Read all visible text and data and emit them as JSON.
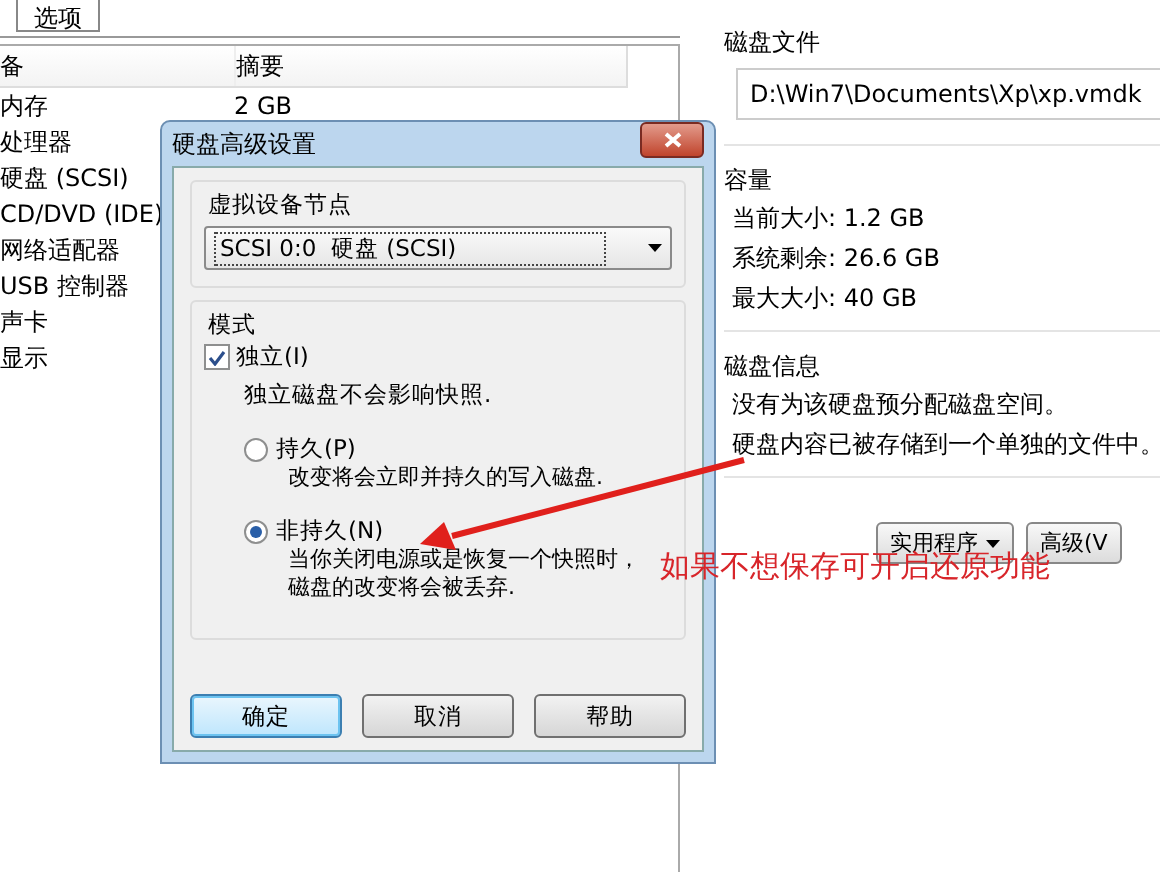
{
  "tabs": [
    {
      "label": "选项",
      "selected": true
    }
  ],
  "device_list": {
    "columns": [
      "备",
      "摘要"
    ],
    "rows": [
      {
        "device": "内存",
        "summary": "2 GB"
      },
      {
        "device": "处理器",
        "summary": ""
      },
      {
        "device": "硬盘 (SCSI)",
        "summary": ""
      },
      {
        "device": "CD/DVD (IDE)",
        "summary": ""
      },
      {
        "device": "网络适配器",
        "summary": ""
      },
      {
        "device": "USB 控制器",
        "summary": ""
      },
      {
        "device": "声卡",
        "summary": ""
      },
      {
        "device": "显示",
        "summary": ""
      }
    ]
  },
  "details": {
    "disk_file": {
      "title": "磁盘文件",
      "value": "D:\\Win7\\Documents\\Xp\\xp.vmdk"
    },
    "capacity": {
      "title": "容量",
      "lines": [
        "当前大小: 1.2 GB",
        "系统剩余: 26.6 GB",
        "最大大小: 40 GB"
      ]
    },
    "disk_info": {
      "title": "磁盘信息",
      "lines": [
        "没有为该硬盘预分配磁盘空间。",
        "硬盘内容已被存储到一个单独的文件中。"
      ]
    },
    "buttons": [
      {
        "label": "实用程序",
        "dropdown": true
      },
      {
        "label": "高级(V",
        "dropdown": false
      }
    ]
  },
  "dialog": {
    "title": "硬盘高级设置",
    "node": {
      "title": "虚拟设备节点",
      "value": "SCSI 0:0  硬盘 (SCSI)"
    },
    "mode": {
      "title": "模式",
      "independent": {
        "label": "独立(I)",
        "checked": true
      },
      "note": "独立磁盘不会影响快照.",
      "options": [
        {
          "label": "持久(P)",
          "selected": false,
          "description_lines": [
            "改变将会立即并持久的写入磁盘."
          ]
        },
        {
          "label": "非持久(N)",
          "selected": true,
          "description_lines": [
            "当你关闭电源或是恢复一个快照时，",
            "磁盘的改变将会被丢弃."
          ]
        }
      ]
    },
    "buttons": [
      {
        "label": "确定",
        "default": true
      },
      {
        "label": "取消",
        "default": false
      },
      {
        "label": "帮助",
        "default": false
      }
    ]
  },
  "annotation": {
    "text": "如果不想保存可开启还原功能"
  }
}
